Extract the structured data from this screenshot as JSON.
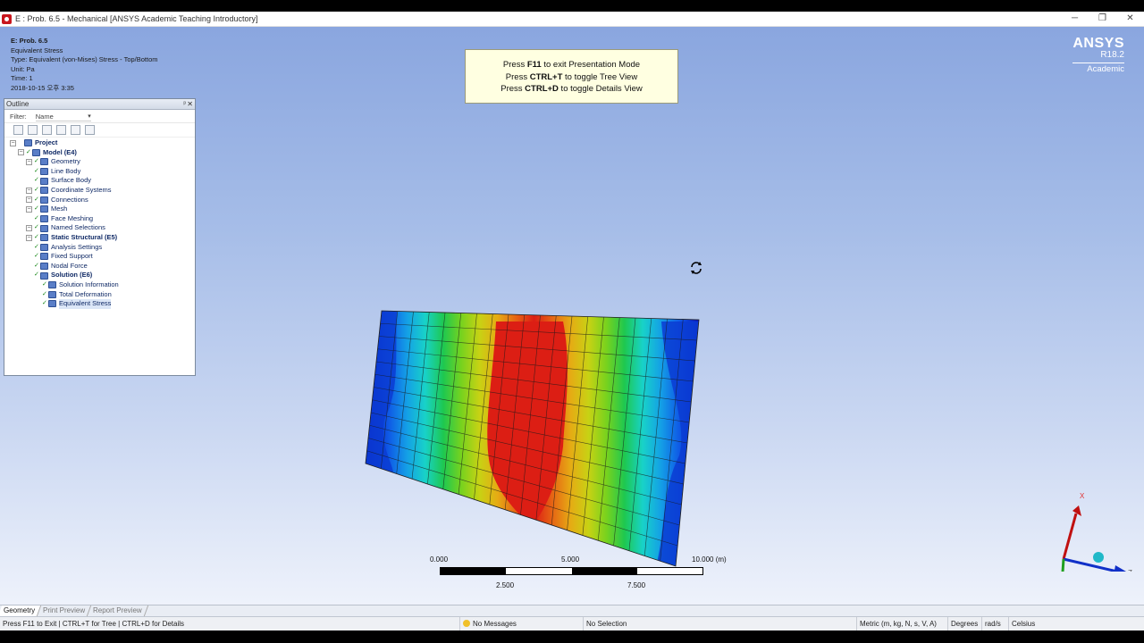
{
  "window": {
    "title": "E : Prob. 6.5 - Mechanical [ANSYS Academic Teaching Introductory]",
    "minimize": "─",
    "restore": "❐",
    "close": "✕"
  },
  "info": {
    "title": "E: Prob. 6.5",
    "result": "Equivalent Stress",
    "type": "Type: Equivalent (von-Mises) Stress - Top/Bottom",
    "unit": "Unit: Pa",
    "time": "Time: 1",
    "date": "2018-10-15 오후 3:35"
  },
  "hint": {
    "line1_pre": "Press ",
    "line1_key": "F11",
    "line1_post": " to exit Presentation Mode",
    "line2_pre": "Press ",
    "line2_key": "CTRL+T",
    "line2_post": " to toggle Tree View",
    "line3_pre": "Press ",
    "line3_key": "CTRL+D",
    "line3_post": " to toggle Details View"
  },
  "logo": {
    "brand": "ANSYS",
    "version": "R18.2",
    "edition": "Academic"
  },
  "outline": {
    "title": "Outline",
    "pin": "ᵖ",
    "close": "✕",
    "filter_label": "Filter:",
    "filter_value": "Name",
    "tree": [
      {
        "label": "Project",
        "indent": 0,
        "bold": true
      },
      {
        "label": "Model (E4)",
        "indent": 1,
        "bold": true
      },
      {
        "label": "Geometry",
        "indent": 2
      },
      {
        "label": "Line Body",
        "indent": 3
      },
      {
        "label": "Surface Body",
        "indent": 3
      },
      {
        "label": "Coordinate Systems",
        "indent": 2
      },
      {
        "label": "Connections",
        "indent": 2
      },
      {
        "label": "Mesh",
        "indent": 2
      },
      {
        "label": "Face Meshing",
        "indent": 3
      },
      {
        "label": "Named Selections",
        "indent": 2
      },
      {
        "label": "Static Structural (E5)",
        "indent": 2,
        "bold": true
      },
      {
        "label": "Analysis Settings",
        "indent": 3
      },
      {
        "label": "Fixed Support",
        "indent": 3
      },
      {
        "label": "Nodal Force",
        "indent": 3
      },
      {
        "label": "Solution (E6)",
        "indent": 3,
        "bold": true
      },
      {
        "label": "Solution Information",
        "indent": 4
      },
      {
        "label": "Total Deformation",
        "indent": 4
      },
      {
        "label": "Equivalent Stress",
        "indent": 4,
        "selected": true
      }
    ]
  },
  "scale": {
    "label_0": "0.000",
    "label_5": "5.000",
    "label_10": "10.000 (m)",
    "label_2_5": "2.500",
    "label_7_5": "7.500"
  },
  "triad": {
    "x": "X",
    "z": "Z"
  },
  "tabs": [
    "Geometry",
    "Print Preview",
    "Report Preview"
  ],
  "status": {
    "hint": "Press F11 to Exit | CTRL+T for Tree | CTRL+D for Details",
    "messages": "No Messages",
    "selection": "No Selection",
    "units": "Metric (m, kg, N, s, V, A)",
    "angle": "Degrees",
    "rate": "rad/s",
    "temp": "Celsius"
  },
  "colors": {
    "contour": [
      "#0a1ec8",
      "#0f5be6",
      "#14a0e6",
      "#18d2c8",
      "#1ec850",
      "#78d21e",
      "#c8d214",
      "#e6aa14",
      "#e66414",
      "#dc1e14"
    ]
  }
}
